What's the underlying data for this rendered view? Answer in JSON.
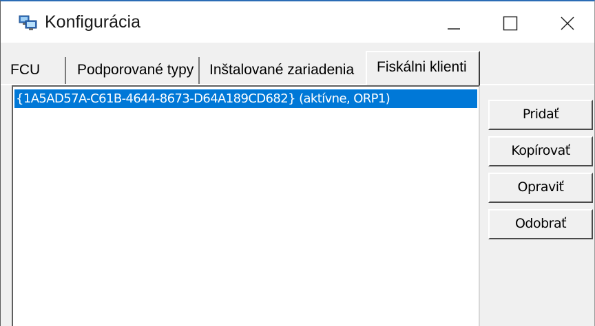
{
  "window": {
    "title": "Konfigurácia",
    "icon": "network-computers-icon",
    "controls": [
      "minimize-icon",
      "maximize-icon",
      "close-icon"
    ]
  },
  "tabs": [
    {
      "label": "FCU",
      "selected": false
    },
    {
      "label": "Podporované typy",
      "selected": false
    },
    {
      "label": "Inštalované zariadenia",
      "selected": false
    },
    {
      "label": "Fiskálni klienti",
      "selected": true
    }
  ],
  "list": {
    "items": [
      {
        "text": "{1A5AD57A-C61B-4644-8673-D64A189CD682} (aktívne, ORP1)",
        "selected": true
      }
    ]
  },
  "buttons": {
    "add": "Pridať",
    "copy": "Kopírovať",
    "edit": "Opraviť",
    "remove": "Odobrať"
  },
  "colors": {
    "title_accent": "#2b6cb5",
    "selection": "#0078d7",
    "dialog_face": "#f0f0f0"
  }
}
